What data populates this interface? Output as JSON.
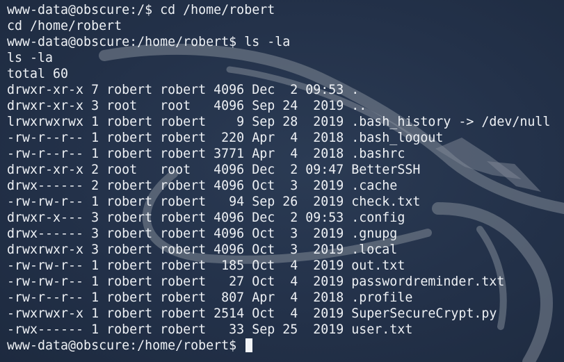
{
  "terminal": {
    "lines": [
      "www-data@obscure:/$ cd /home/robert",
      "cd /home/robert",
      "www-data@obscure:/home/robert$ ls -la",
      "ls -la",
      "total 60",
      "drwxr-xr-x 7 robert robert 4096 Dec  2 09:53 .",
      "drwxr-xr-x 3 root   root   4096 Sep 24  2019 ..",
      "lrwxrwxrwx 1 robert robert    9 Sep 28  2019 .bash_history -> /dev/null",
      "-rw-r--r-- 1 robert robert  220 Apr  4  2018 .bash_logout",
      "-rw-r--r-- 1 robert robert 3771 Apr  4  2018 .bashrc",
      "drwxr-xr-x 2 root   root   4096 Dec  2 09:47 BetterSSH",
      "drwx------ 2 robert robert 4096 Oct  3  2019 .cache",
      "-rw-rw-r-- 1 robert robert   94 Sep 26  2019 check.txt",
      "drwxr-x--- 3 robert robert 4096 Dec  2 09:53 .config",
      "drwx------ 3 robert robert 4096 Oct  3  2019 .gnupg",
      "drwxrwxr-x 3 robert robert 4096 Oct  3  2019 .local",
      "-rw-rw-r-- 1 robert robert  185 Oct  4  2019 out.txt",
      "-rw-rw-r-- 1 robert robert   27 Oct  4  2019 passwordreminder.txt",
      "-rw-r--r-- 1 robert robert  807 Apr  4  2018 .profile",
      "-rwxrwxr-x 1 robert robert 2514 Oct  4  2019 SuperSecureCrypt.py",
      "-rwx------ 1 robert robert   33 Sep 25  2019 user.txt"
    ],
    "prompt": "www-data@obscure:/home/robert$ "
  },
  "colors": {
    "background": "#243349",
    "text": "#eef1f5",
    "watermark": "#7f8896",
    "cursor": "#f2f4f7"
  },
  "icons": {
    "watermark": "kali-dragon-logo"
  }
}
